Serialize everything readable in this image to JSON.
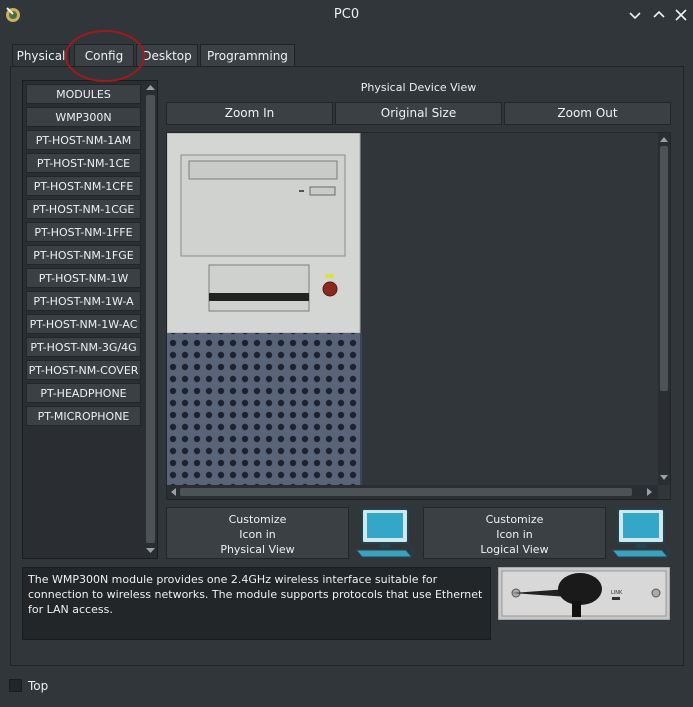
{
  "window": {
    "title": "PC0"
  },
  "tabs": [
    {
      "label": "Physical",
      "active": true
    },
    {
      "label": "Config",
      "active": false
    },
    {
      "label": "Desktop",
      "active": false
    },
    {
      "label": "Programming",
      "active": false
    }
  ],
  "modules": {
    "items": [
      "MODULES",
      "WMP300N",
      "PT-HOST-NM-1AM",
      "PT-HOST-NM-1CE",
      "PT-HOST-NM-1CFE",
      "PT-HOST-NM-1CGE",
      "PT-HOST-NM-1FFE",
      "PT-HOST-NM-1FGE",
      "PT-HOST-NM-1W",
      "PT-HOST-NM-1W-A",
      "PT-HOST-NM-1W-AC",
      "PT-HOST-NM-3G/4G",
      "PT-HOST-NM-COVER",
      "PT-HEADPHONE",
      "PT-MICROPHONE"
    ]
  },
  "device_view": {
    "title": "Physical Device View",
    "zoom_in": "Zoom In",
    "original_size": "Original Size",
    "zoom_out": "Zoom Out"
  },
  "customize": {
    "physical": {
      "line1": "Customize",
      "line2": "Icon in",
      "line3": "Physical View"
    },
    "logical": {
      "line1": "Customize",
      "line2": "Icon in",
      "line3": "Logical View"
    }
  },
  "description": "The WMP300N module provides one 2.4GHz wireless interface suitable for connection to wireless networks. The module supports protocols that use Ethernet for LAN access.",
  "module_image": {
    "port_label": "LINK"
  },
  "footer": {
    "top_label": "Top"
  },
  "colors": {
    "background": "#31363b",
    "panel": "#3b4045",
    "annotation": "#a01a1a"
  }
}
